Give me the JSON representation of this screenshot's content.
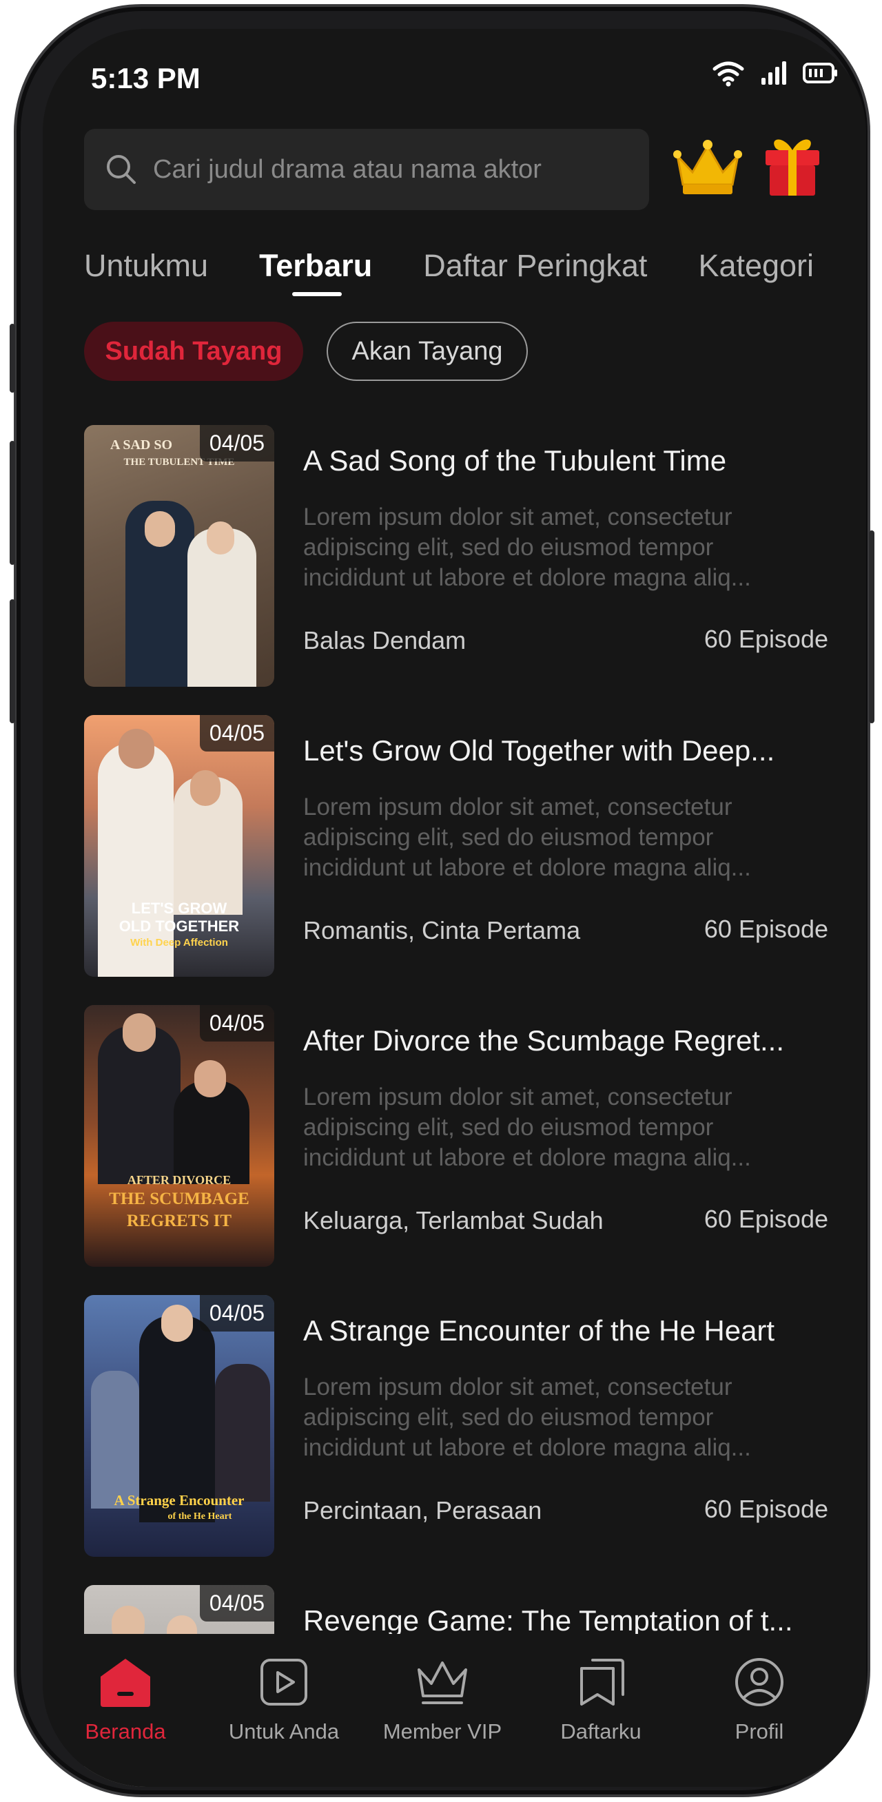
{
  "status": {
    "time": "5:13 PM"
  },
  "search": {
    "placeholder": "Cari judul drama atau nama aktor"
  },
  "header": {
    "icons": [
      "search-icon",
      "crown-icon",
      "gift-icon"
    ]
  },
  "tabs": [
    {
      "label": "Untukmu",
      "active": false
    },
    {
      "label": "Terbaru",
      "active": true
    },
    {
      "label": "Daftar Peringkat",
      "active": false
    },
    {
      "label": "Kategori",
      "active": false
    }
  ],
  "filters": [
    {
      "label": "Sudah Tayang",
      "active": true
    },
    {
      "label": "Akan Tayang",
      "active": false
    }
  ],
  "dramas": [
    {
      "date": "04/05",
      "poster_text": [
        "A SAD SO",
        "THE TUBULENT TIME"
      ],
      "title": "A Sad Song of the Tubulent Time",
      "description": "Lorem ipsum dolor sit amet, consectetur adipiscing elit, sed do eiusmod tempor incididunt ut labore et dolore magna aliq...",
      "genre": "Balas Dendam",
      "episodes": "60 Episode"
    },
    {
      "date": "04/05",
      "poster_text": [
        "LET'S GROW",
        "OLD TOGETHER",
        "With Deep Affection"
      ],
      "title": "Let's Grow Old Together with Deep...",
      "description": "Lorem ipsum dolor sit amet, consectetur adipiscing elit, sed do eiusmod tempor incididunt ut labore et dolore magna aliq...",
      "genre": "Romantis, Cinta Pertama",
      "episodes": "60 Episode"
    },
    {
      "date": "04/05",
      "poster_text": [
        "AFTER DIVORCE",
        "THE SCUMBAGE",
        "REGRETS IT"
      ],
      "title": "After Divorce the Scumbage Regret...",
      "description": "Lorem ipsum dolor sit amet, consectetur adipiscing elit, sed do eiusmod tempor incididunt ut labore et dolore magna aliq...",
      "genre": "Keluarga, Terlambat Sudah",
      "episodes": "60 Episode"
    },
    {
      "date": "04/05",
      "poster_text": [
        "A Strange Encounter",
        "of the He Heart"
      ],
      "title": "A Strange Encounter of the He Heart",
      "description": "Lorem ipsum dolor sit amet, consectetur adipiscing elit, sed do eiusmod tempor incididunt ut labore et dolore magna aliq...",
      "genre": "Percintaan, Perasaan",
      "episodes": "60 Episode"
    },
    {
      "date": "04/05",
      "title": "Revenge Game: The Temptation of t..."
    }
  ],
  "bottom_nav": [
    {
      "label": "Beranda",
      "icon": "home-icon",
      "active": true
    },
    {
      "label": "Untuk Anda",
      "icon": "play-icon",
      "active": false
    },
    {
      "label": "Member VIP",
      "icon": "crown-outline-icon",
      "active": false
    },
    {
      "label": "Daftarku",
      "icon": "bookmark-icon",
      "active": false
    },
    {
      "label": "Profil",
      "icon": "profile-icon",
      "active": false
    }
  ],
  "colors": {
    "accent": "#e0263b",
    "background": "#161616"
  }
}
